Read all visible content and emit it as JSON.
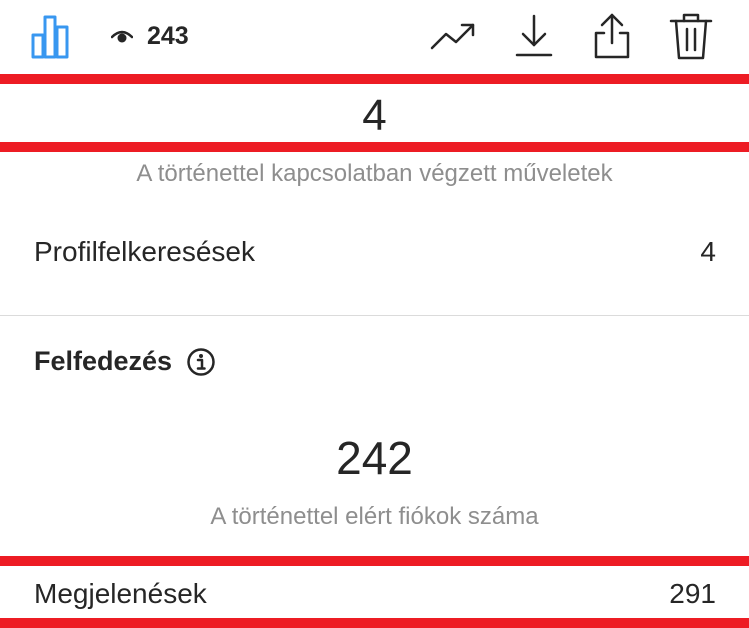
{
  "header": {
    "views_count": "243",
    "accent_color": "#3897f0",
    "icons": [
      "bar-chart-icon",
      "eye-icon",
      "trend-arrow-icon",
      "download-icon",
      "share-icon",
      "trash-icon"
    ]
  },
  "interactions": {
    "total": "4",
    "caption": "A történettel kapcsolatban végzett műveletek",
    "rows": [
      {
        "label": "Profilfelkeresések",
        "value": "4"
      }
    ]
  },
  "discovery": {
    "title": "Felfedezés",
    "reach": "242",
    "reach_caption": "A történettel elért fiókok száma",
    "rows": [
      {
        "label": "Megjelenések",
        "value": "291"
      }
    ]
  },
  "highlight_color": "#ed1c24"
}
